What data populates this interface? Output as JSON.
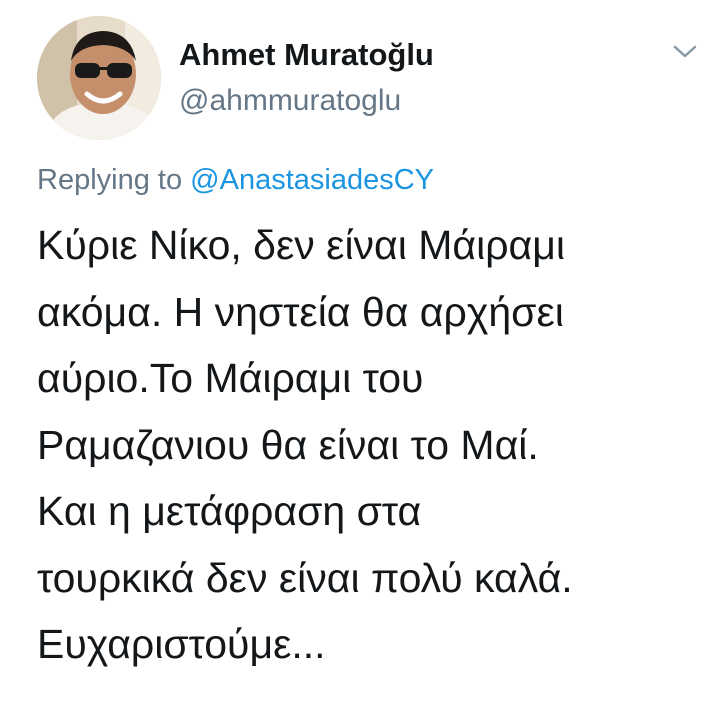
{
  "author": {
    "display_name": "Ahmet Muratoğlu",
    "handle": "@ahmmuratoglu",
    "avatar_icon": "profile-photo-sunglasses"
  },
  "menu": {
    "icon": "chevron-down-icon"
  },
  "reply": {
    "prefix": "Replying to ",
    "mention": "@AnastasiadesCY"
  },
  "tweet": {
    "lines": [
      "Κύριε Νίκο, δεν είναι Μάιραμι",
      "ακόμα. Η νηστεία θα αρχήσει",
      "αύριο.Το Μάιραμι του",
      "Ραμαζανιου θα είναι το Μαί.",
      "Και η μετάφραση στα",
      "τουρκικά δεν είναι πολύ καλά.",
      "Ευχαριστούμε..."
    ]
  },
  "colors": {
    "text": "#14171a",
    "secondary": "#657786",
    "link": "#1b95e0",
    "background": "#ffffff"
  }
}
